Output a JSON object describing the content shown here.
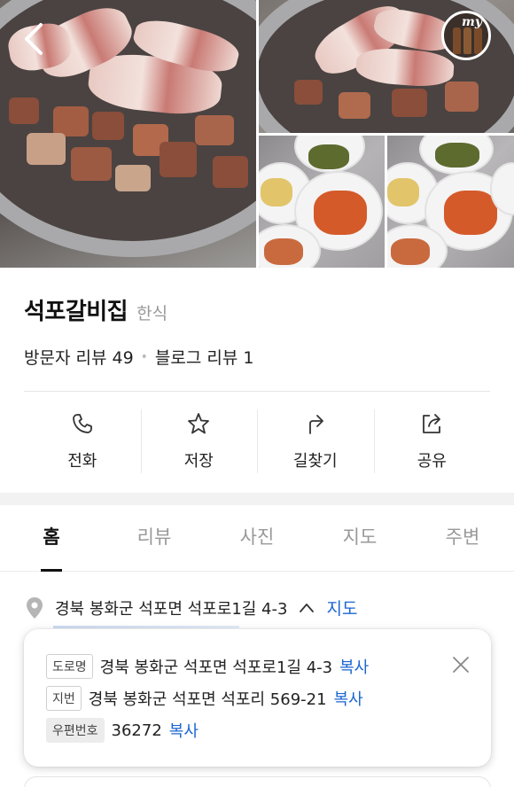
{
  "header": {
    "back_icon": "chevron-left-icon",
    "badge_text": "my"
  },
  "place": {
    "name": "석포갈비집",
    "category": "한식",
    "visitor_reviews": "방문자 리뷰 49",
    "separator": "•",
    "blog_reviews": "블로그 리뷰 1"
  },
  "actions": [
    {
      "label": "전화",
      "icon": "phone-icon"
    },
    {
      "label": "저장",
      "icon": "star-icon"
    },
    {
      "label": "길찾기",
      "icon": "directions-icon"
    },
    {
      "label": "공유",
      "icon": "share-icon"
    }
  ],
  "tabs": [
    {
      "label": "홈",
      "active": true
    },
    {
      "label": "리뷰",
      "active": false
    },
    {
      "label": "사진",
      "active": false
    },
    {
      "label": "지도",
      "active": false
    },
    {
      "label": "주변",
      "active": false
    }
  ],
  "address": {
    "text": "경북 봉화군 석포면 석포로1길 4-3",
    "map_link": "지도"
  },
  "address_popup": {
    "road_tag": "도로명",
    "road_address": "경북 봉화군 석포면 석포로1길 4-3",
    "jibun_tag": "지번",
    "jibun_address": "경북 봉화군 석포면 석포리 569-21",
    "postal_tag": "우편번호",
    "postal_code": "36272",
    "copy_label": "복사"
  },
  "colors": {
    "link": "#1a66d0",
    "active_tab": "#111111",
    "inactive_tab": "#999999"
  }
}
